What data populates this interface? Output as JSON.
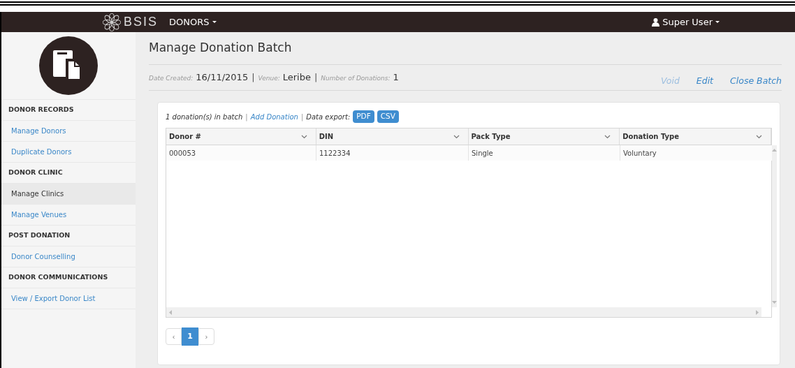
{
  "navbar": {
    "brand": "BSIS",
    "menu": "DONORS",
    "user": "Super User"
  },
  "sidebar": {
    "items": [
      {
        "kind": "heading",
        "label": "DONOR RECORDS",
        "selected": false
      },
      {
        "kind": "link",
        "label": "Manage Donors",
        "selected": false
      },
      {
        "kind": "link",
        "label": "Duplicate Donors",
        "selected": false
      },
      {
        "kind": "heading",
        "label": "DONOR CLINIC",
        "selected": false
      },
      {
        "kind": "link",
        "label": "Manage Clinics",
        "selected": true
      },
      {
        "kind": "link",
        "label": "Manage Venues",
        "selected": false
      },
      {
        "kind": "heading",
        "label": "POST DONATION",
        "selected": false
      },
      {
        "kind": "link",
        "label": "Donor Counselling",
        "selected": false
      },
      {
        "kind": "heading",
        "label": "DONOR COMMUNICATIONS",
        "selected": false
      },
      {
        "kind": "link",
        "label": "View / Export Donor List",
        "selected": false
      }
    ]
  },
  "page": {
    "title": "Manage Donation Batch",
    "details": [
      {
        "label": "Date Created:",
        "value": "16/11/2015"
      },
      {
        "label": "Venue:",
        "value": "Leribe"
      },
      {
        "label": "Number of Donations:",
        "value": "1"
      }
    ],
    "separator": "|",
    "actions": [
      {
        "label": "Void",
        "disabled": true
      },
      {
        "label": "Edit",
        "disabled": false
      },
      {
        "label": "Close Batch",
        "disabled": false
      }
    ]
  },
  "batch": {
    "summary": "1 donation(s) in batch",
    "add_link": "Add Donation",
    "export_label": "Data export:",
    "export_buttons": [
      "PDF",
      "CSV"
    ]
  },
  "table": {
    "columns": [
      "Donor #",
      "DIN",
      "Pack Type",
      "Donation Type"
    ],
    "rows": [
      [
        "000053",
        "1122334",
        "Single",
        "Voluntary"
      ]
    ]
  },
  "pagination": {
    "prev": "‹",
    "next": "›",
    "pages": [
      {
        "label": "1",
        "selected": true
      }
    ]
  }
}
